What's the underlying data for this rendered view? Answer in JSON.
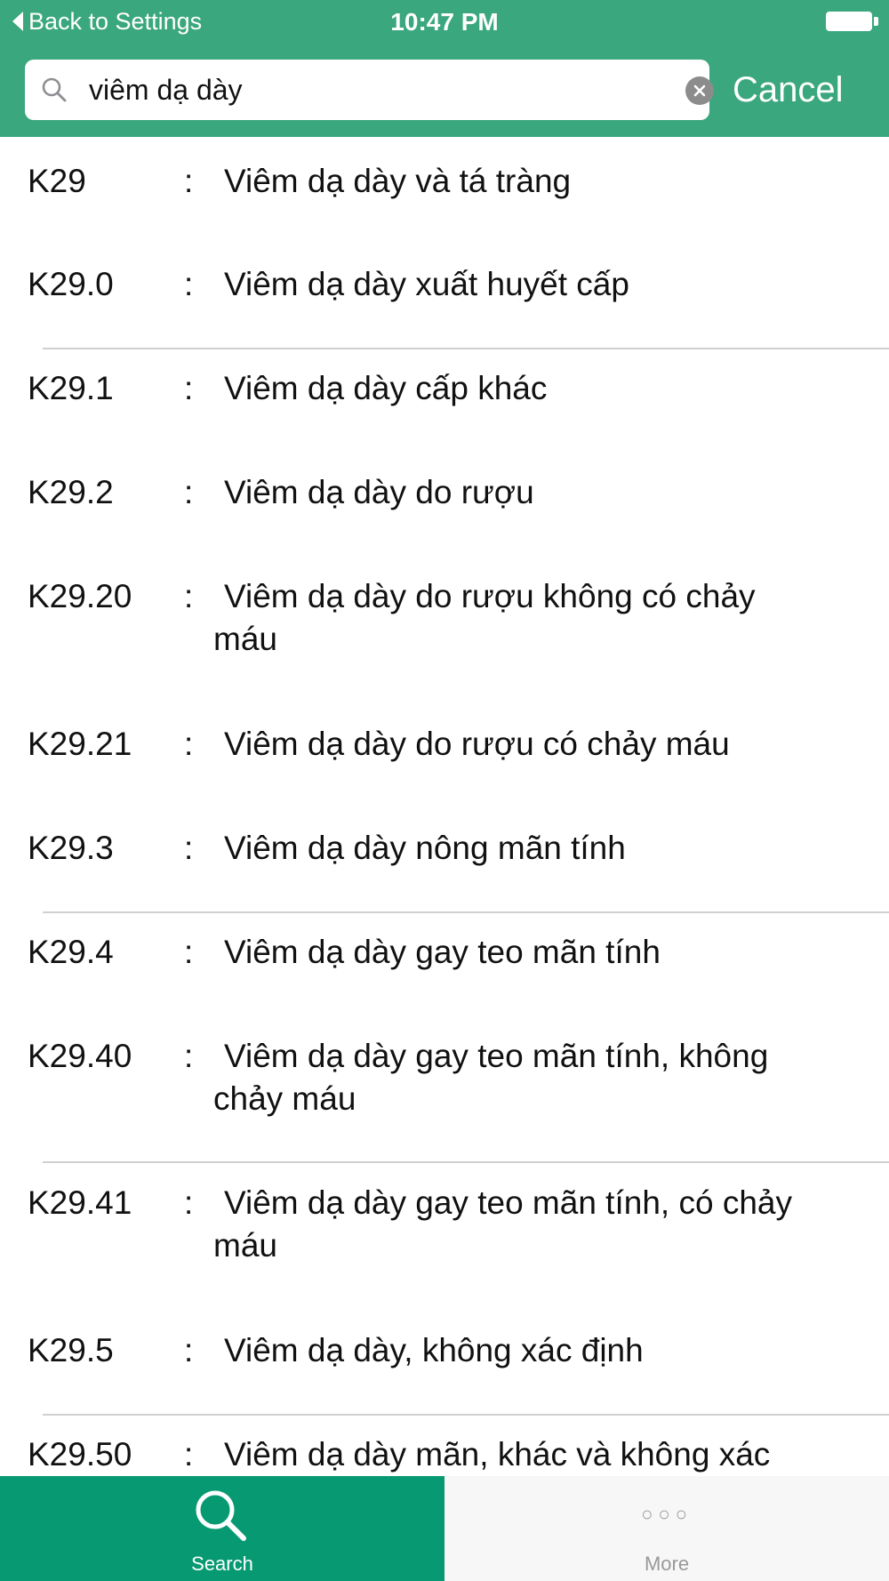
{
  "status_bar": {
    "back_label": "Back to Settings",
    "time": "10:47 PM"
  },
  "search": {
    "value": "viêm dạ dày",
    "cancel_label": "Cancel"
  },
  "results": [
    {
      "code": "K29",
      "sep": ":",
      "line1": "Viêm dạ dày và tá tràng",
      "line2": ""
    },
    {
      "code": "K29.0",
      "sep": ":",
      "line1": "Viêm dạ dày xuất huyết cấp",
      "line2": ""
    },
    {
      "code": "K29.1",
      "sep": ":",
      "line1": "Viêm dạ dày cấp khác",
      "line2": ""
    },
    {
      "code": "K29.2",
      "sep": ":",
      "line1": "Viêm dạ dày do rượu",
      "line2": ""
    },
    {
      "code": "K29.20",
      "sep": ":",
      "line1": "Viêm dạ dày do rượu không có chảy",
      "line2": "máu"
    },
    {
      "code": "K29.21",
      "sep": ":",
      "line1": "Viêm dạ dày do rượu có chảy máu",
      "line2": ""
    },
    {
      "code": "K29.3",
      "sep": ":",
      "line1": "Viêm dạ dày nông mãn tính",
      "line2": ""
    },
    {
      "code": "K29.4",
      "sep": ":",
      "line1": "Viêm dạ dày gay teo mãn tính",
      "line2": ""
    },
    {
      "code": "K29.40",
      "sep": ":",
      "line1": "Viêm dạ dày gay teo mãn tính, không",
      "line2": "chảy máu"
    },
    {
      "code": "K29.41",
      "sep": ":",
      "line1": "Viêm dạ dày gay teo mãn tính, có chảy",
      "line2": "máu"
    },
    {
      "code": "K29.5",
      "sep": ":",
      "line1": "Viêm dạ dày, không xác định",
      "line2": ""
    },
    {
      "code": "K29.50",
      "sep": ":",
      "line1": "Viêm dạ dày mãn, khác và không xác",
      "line2": ""
    }
  ],
  "tab_bar": {
    "search_label": "Search",
    "search_icon": "search-icon",
    "more_label": "More",
    "more_icon": "more-dots-icon",
    "active_color": "#079a72"
  },
  "colors": {
    "header": "#3aa77e",
    "tab_active": "#079a72"
  }
}
